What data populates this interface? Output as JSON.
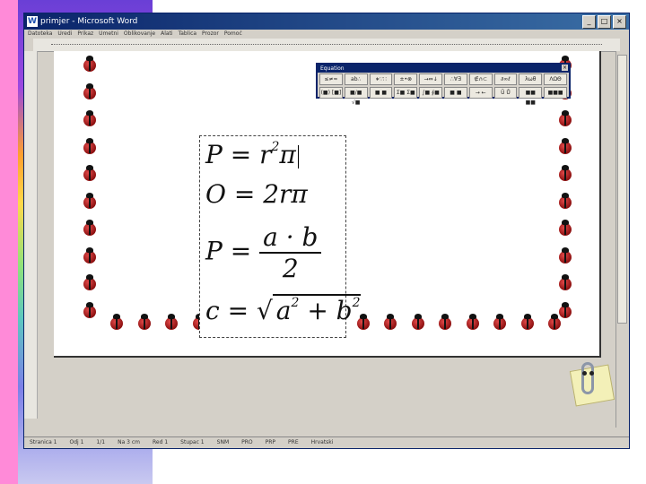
{
  "window": {
    "title": "primjer - Microsoft Word",
    "menu": [
      "Datoteka",
      "Uredi",
      "Prikaz",
      "Umetni",
      "Oblikovanje",
      "Alati",
      "Tablica",
      "Prozor",
      "Pomoć"
    ]
  },
  "equation_toolbar": {
    "title": "Equation",
    "row1": [
      "≤≠≈",
      "ab∴",
      "∗∵∷",
      "±•⊗",
      "→⇔↓",
      "∴∀∃",
      "∉∩⊂",
      "∂∞ℓ",
      "λωθ",
      "ΛΩΘ"
    ],
    "row2": [
      "(■) [■]",
      "■/■ √■",
      "■ ■",
      "Σ■ Σ■",
      "∫■ ∮■",
      "■ ■",
      "→ ←",
      "Ū Ů",
      "■■ ■■",
      "■■■"
    ]
  },
  "equations": [
    {
      "lhs": "P",
      "rhs": "r",
      "exp": "2",
      "tail": "π"
    },
    {
      "lhs": "O",
      "rhs": "2rπ"
    },
    {
      "lhs": "P",
      "num": "a · b",
      "den": "2"
    },
    {
      "lhs": "c",
      "radicand": "a",
      "exp1": "2",
      "plus": " + b",
      "exp2": "2"
    }
  ],
  "status": [
    "Stranica 1",
    "Odj 1",
    "1/1",
    "Na 3 cm",
    "Red 1",
    "Stupac 1",
    "SNM",
    "PRO",
    "PRP",
    "PRE",
    "Hrvatski"
  ]
}
